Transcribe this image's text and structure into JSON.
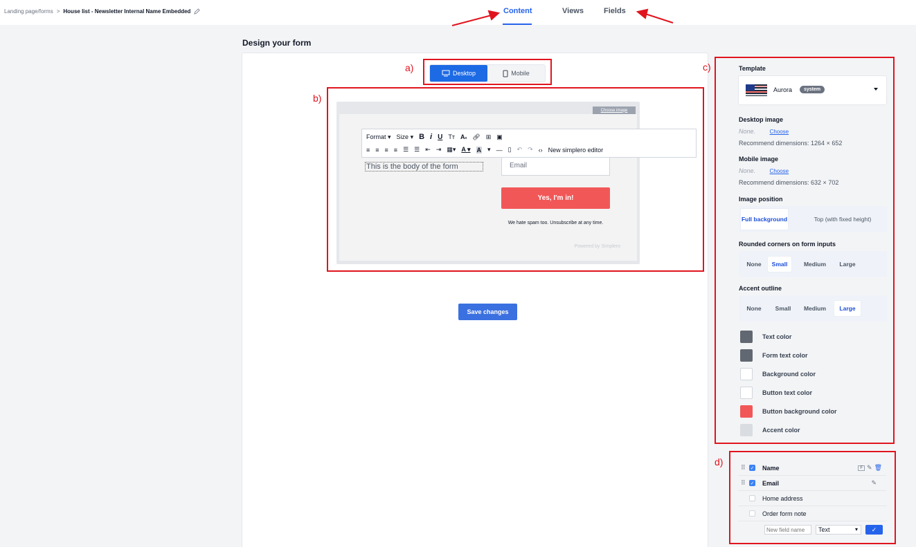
{
  "breadcrumb": {
    "parent": "Landing page/forms",
    "separator": ">",
    "current": "House list - Newsletter Internal Name Embedded"
  },
  "tabs": [
    {
      "label": "Content",
      "active": true
    },
    {
      "label": "Views",
      "active": false
    },
    {
      "label": "Fields",
      "active": false
    }
  ],
  "page_title": "Design your form",
  "annotations": {
    "a": "a)",
    "b": "b)",
    "c": "c)",
    "d": "d)"
  },
  "device_toggle": {
    "desktop": "Desktop",
    "mobile": "Mobile",
    "selected": "Desktop"
  },
  "preview": {
    "choose_image": "Choose image",
    "toolbar": {
      "format": "Format",
      "size": "Size",
      "new_editor": "New simplero editor"
    },
    "body_text": "This is the body of the form",
    "email_placeholder": "Email",
    "submit_label": "Yes, I'm in!",
    "spam_note": "We hate spam too. Unsubscribe at any time.",
    "powered_by": "Powered by Simplero"
  },
  "save_button": "Save changes",
  "settings": {
    "template_label": "Template",
    "template_name": "Aurora",
    "template_badge": "system",
    "desktop_image_label": "Desktop image",
    "desktop_image_value": "None.",
    "desktop_image_choose": "Choose",
    "desktop_image_dims": "Recommend dimensions: 1264 × 652",
    "mobile_image_label": "Mobile image",
    "mobile_image_value": "None.",
    "mobile_image_choose": "Choose",
    "mobile_image_dims": "Recommend dimensions: 632 × 702",
    "image_position_label": "Image position",
    "image_position_options": [
      "Full background",
      "Top (with fixed height)"
    ],
    "image_position_selected": "Full background",
    "rounded_label": "Rounded corners on form inputs",
    "rounded_options": [
      "None",
      "Small",
      "Medium",
      "Large"
    ],
    "rounded_selected": "Small",
    "accent_label": "Accent outline",
    "accent_options": [
      "None",
      "Small",
      "Medium",
      "Large"
    ],
    "accent_selected": "Large",
    "colors": [
      {
        "label": "Text color",
        "value": "#626872"
      },
      {
        "label": "Form text color",
        "value": "#626872"
      },
      {
        "label": "Background color",
        "value": "#ffffff"
      },
      {
        "label": "Button text color",
        "value": "#ffffff"
      },
      {
        "label": "Button background color",
        "value": "#f25757"
      },
      {
        "label": "Accent color",
        "value": "#d9dce1"
      }
    ]
  },
  "fields": {
    "rows": [
      {
        "label": "Name",
        "checked": true,
        "draggable": true,
        "bold": true
      },
      {
        "label": "Email",
        "checked": true,
        "draggable": true,
        "bold": true
      },
      {
        "label": "Home address",
        "checked": false,
        "draggable": false,
        "bold": false
      },
      {
        "label": "Order form note",
        "checked": false,
        "draggable": false,
        "bold": false
      }
    ],
    "name_flag": "F",
    "new_field_placeholder": "New field name",
    "new_field_type": "Text",
    "type_options": [
      "Text"
    ]
  },
  "colors": {
    "accent": "#2563eb",
    "annotation_red": "#e0141e",
    "button_red": "#f25757"
  }
}
